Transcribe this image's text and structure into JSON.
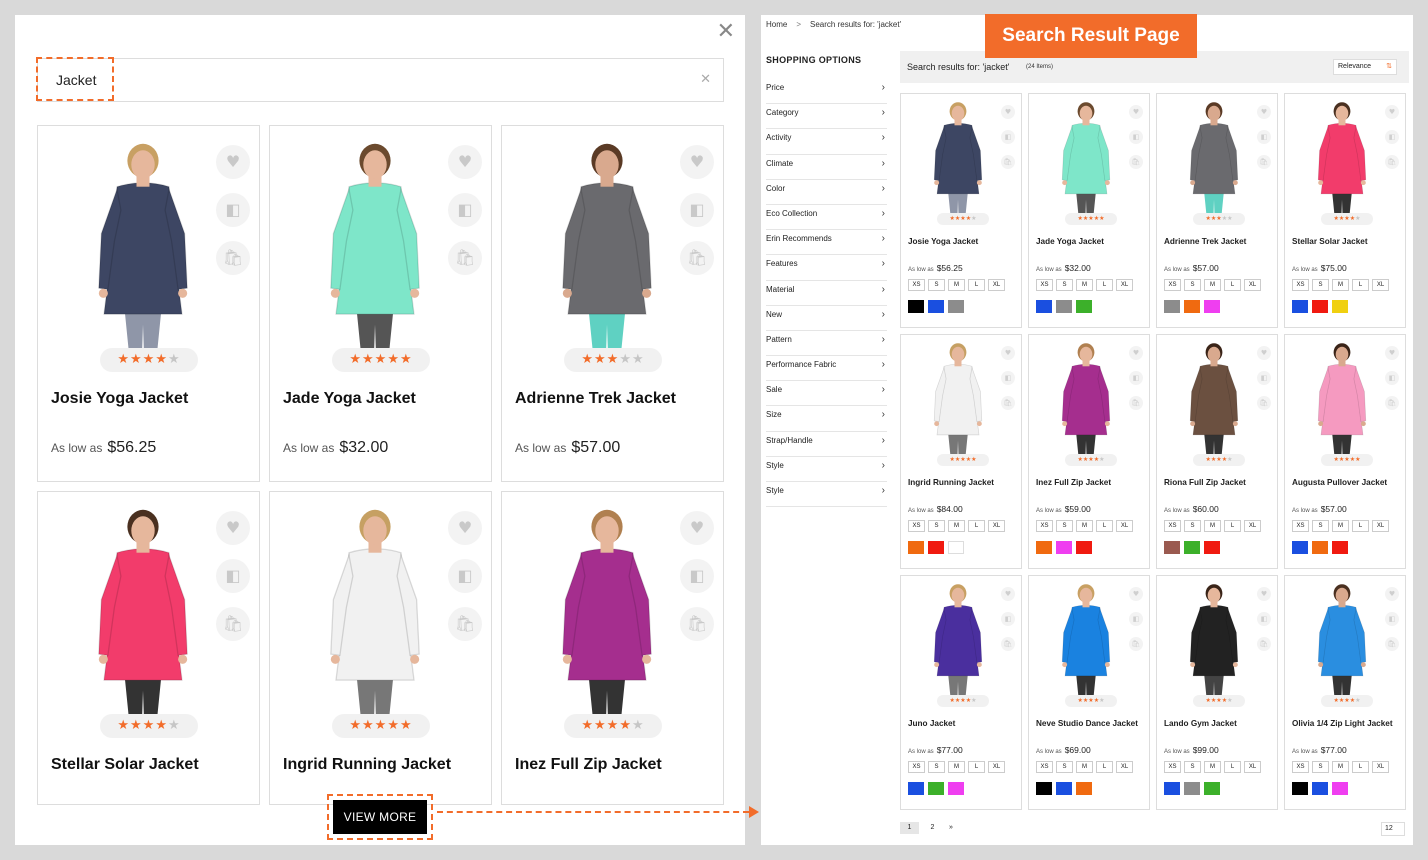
{
  "quick_search": {
    "query": "Jacket",
    "view_more_label": "VIEW MORE",
    "products": [
      {
        "name": "Josie Yoga Jacket",
        "price_label": "As low as",
        "price": "$56.25",
        "rating": 3.5,
        "shirt": "#3d4663",
        "pants": "#8f96a8",
        "hair": "#c8a063",
        "skin": "#e6b79c"
      },
      {
        "name": "Jade Yoga Jacket",
        "price_label": "As low as",
        "price": "$32.00",
        "rating": 4.5,
        "shirt": "#7ee6c9",
        "pants": "#555",
        "hair": "#6b4a2e",
        "skin": "#e6b79c"
      },
      {
        "name": "Adrienne Trek Jacket",
        "price_label": "As low as",
        "price": "$57.00",
        "rating": 3,
        "shirt": "#6a6a6e",
        "pants": "#5fd1c2",
        "hair": "#5a3a25",
        "skin": "#d9a98e"
      },
      {
        "name": "Stellar Solar Jacket",
        "price_label": "As low as",
        "price": "$75.00",
        "rating": 3.5,
        "shirt": "#f23c6b",
        "pants": "#333",
        "hair": "#4a3020",
        "skin": "#e6b79c"
      },
      {
        "name": "Ingrid Running Jacket",
        "price_label": "As low as",
        "price": "$84.00",
        "rating": 4.5,
        "shirt": "#f1f1f1",
        "pants": "#777",
        "hair": "#c6a063",
        "skin": "#e6b79c"
      },
      {
        "name": "Inez Full Zip Jacket",
        "price_label": "As low as",
        "price": "$59.00",
        "rating": 3.5,
        "shirt": "#a52e8e",
        "pants": "#333",
        "hair": "#b08050",
        "skin": "#e6b79c"
      }
    ]
  },
  "results_page": {
    "badge": "Search Result Page",
    "breadcrumb": {
      "home": "Home",
      "sep": ">",
      "current": "Search results for: 'jacket'"
    },
    "sidebar_title": "SHOPPING OPTIONS",
    "filters": [
      "Price",
      "Category",
      "Activity",
      "Climate",
      "Color",
      "Eco Collection",
      "Erin Recommends",
      "Features",
      "Material",
      "New",
      "Pattern",
      "Performance Fabric",
      "Sale",
      "Size",
      "Strap/Handle",
      "Style",
      "Style"
    ],
    "toolbar": {
      "title": "Search results for: 'jacket'",
      "count": "(24 Items)",
      "sort": "Relevance"
    },
    "size_labels": [
      "XS",
      "S",
      "M",
      "L",
      "XL"
    ],
    "price_label": "As low as",
    "products": [
      {
        "name": "Josie Yoga Jacket",
        "price": "$56.25",
        "rating": 3.5,
        "swatches": [
          "#000000",
          "#1a4fe0",
          "#8c8c8c"
        ],
        "shirt": "#3d4663",
        "pants": "#8f96a8",
        "hair": "#c8a063",
        "skin": "#e6b79c"
      },
      {
        "name": "Jade Yoga Jacket",
        "price": "$32.00",
        "rating": 4.5,
        "swatches": [
          "#1a4fe0",
          "#8c8c8c",
          "#3cb02a"
        ],
        "shirt": "#7ee6c9",
        "pants": "#555",
        "hair": "#6b4a2e",
        "skin": "#e6b79c"
      },
      {
        "name": "Adrienne Trek Jacket",
        "price": "$57.00",
        "rating": 3,
        "swatches": [
          "#8c8c8c",
          "#f06a10",
          "#ef3ef0"
        ],
        "shirt": "#6a6a6e",
        "pants": "#5fd1c2",
        "hair": "#5a3a25",
        "skin": "#d9a98e"
      },
      {
        "name": "Stellar Solar Jacket",
        "price": "$75.00",
        "rating": 3.5,
        "swatches": [
          "#1a4fe0",
          "#f01a10",
          "#f0d010"
        ],
        "shirt": "#f23c6b",
        "pants": "#333",
        "hair": "#4a3020",
        "skin": "#e6b79c"
      },
      {
        "name": "Ingrid Running Jacket",
        "price": "$84.00",
        "rating": 4.5,
        "swatches": [
          "#f06a10",
          "#f01a10",
          "#ffffff"
        ],
        "shirt": "#f1f1f1",
        "pants": "#777",
        "hair": "#c6a063",
        "skin": "#e6b79c"
      },
      {
        "name": "Inez Full Zip Jacket",
        "price": "$59.00",
        "rating": 3.5,
        "swatches": [
          "#f06a10",
          "#ef3ef0",
          "#f01a10"
        ],
        "shirt": "#a52e8e",
        "pants": "#333",
        "hair": "#b08050",
        "skin": "#e6b79c"
      },
      {
        "name": "Riona Full Zip Jacket",
        "price": "$60.00",
        "rating": 3.5,
        "swatches": [
          "#9a5a50",
          "#3cb02a",
          "#f01a10"
        ],
        "shirt": "#6b5040",
        "pants": "#333",
        "hair": "#3a2418",
        "skin": "#d9a98e"
      },
      {
        "name": "Augusta Pullover Jacket",
        "price": "$57.00",
        "rating": 4.5,
        "swatches": [
          "#1a4fe0",
          "#f06a10",
          "#f01a10"
        ],
        "shirt": "#f59ac0",
        "pants": "#333",
        "hair": "#3a2418",
        "skin": "#d9a98e"
      },
      {
        "name": "Juno Jacket",
        "price": "$77.00",
        "rating": 3.5,
        "swatches": [
          "#1a4fe0",
          "#3cb02a",
          "#ef3ef0"
        ],
        "shirt": "#4a2f9e",
        "pants": "#777",
        "hair": "#c8a063",
        "skin": "#e6b79c"
      },
      {
        "name": "Neve Studio Dance Jacket",
        "price": "$69.00",
        "rating": 3.5,
        "swatches": [
          "#000000",
          "#1a4fe0",
          "#f06a10"
        ],
        "shirt": "#1a82e0",
        "pants": "#333",
        "hair": "#c8a063",
        "skin": "#e6b79c"
      },
      {
        "name": "Lando Gym Jacket",
        "price": "$99.00",
        "rating": 3.5,
        "swatches": [
          "#1a4fe0",
          "#8c8c8c",
          "#3cb02a"
        ],
        "shirt": "#222",
        "pants": "#444",
        "hair": "#3a2418",
        "skin": "#e6b79c"
      },
      {
        "name": "Olivia 1/4 Zip Light Jacket",
        "price": "$77.00",
        "rating": 3.5,
        "swatches": [
          "#000000",
          "#1a4fe0",
          "#ef3ef0"
        ],
        "shirt": "#2a8ee0",
        "pants": "#333",
        "hair": "#4a3020",
        "skin": "#d9a98e"
      }
    ],
    "pagination": {
      "pages": [
        "1",
        "2"
      ],
      "current": "1",
      "next": "»",
      "per_page": "12"
    }
  },
  "colors": {
    "accent": "#f26c2a",
    "button": "#000000",
    "star_on": "#f26c2a",
    "star_off": "#c6c6c6"
  },
  "icons": {
    "wishlist": "heart-icon",
    "compare": "compare-icon",
    "cart": "cart-icon",
    "close": "close-icon",
    "clear": "clear-icon",
    "chevron": "chevron-right-icon",
    "next": "next-page-icon"
  }
}
